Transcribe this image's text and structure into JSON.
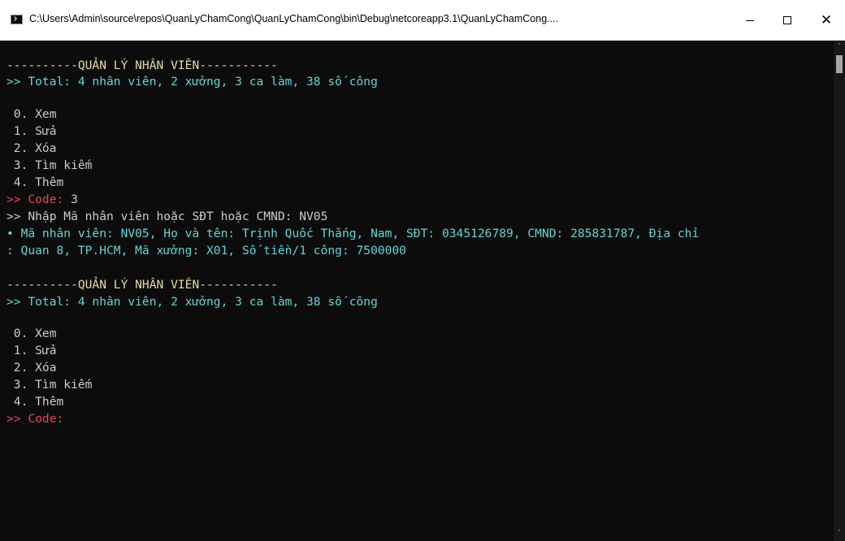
{
  "window": {
    "title": "C:\\Users\\Admin\\source\\repos\\QuanLyChamCong\\QuanLyChamCong\\bin\\Debug\\netcoreapp3.1\\QuanLyChamCong....",
    "minimize_glyph": "—",
    "maximize_glyph": "☐",
    "close_glyph": "✕",
    "icon": "console-icon"
  },
  "colors": {
    "background": "#0c0c0c",
    "header_text": "#e8d8a8",
    "info_text": "#61d6d6",
    "prompt_text": "#e74856",
    "default_text": "#cccccc"
  },
  "console": {
    "block1": {
      "header": "----------QUẢN LÝ NHÂN VIÊN-----------",
      "total": ">> Total: 4 nhân viên, 2 xưởng, 3 ca làm, 38 số công",
      "menu": [
        " 0. Xem",
        " 1. Sửa",
        " 2. Xóa",
        " 3. Tìm kiếm",
        " 4. Thêm"
      ],
      "code_prompt": ">> Code: ",
      "code_value": "3",
      "search_prompt": ">> Nhập Mã nhân viên hoặc SĐT hoặc CMND: NV05",
      "result_line1": "• Mã nhân viên: NV05, Họ và tên: Trịnh Quốc Thắng, Nam, SĐT: 0345126789, CMND: 285831787, Địa chỉ",
      "result_line2": ": Quan 8, TP.HCM, Mã xưởng: X01, Số tiền/1 công: 7500000"
    },
    "block2": {
      "header": "----------QUẢN LÝ NHÂN VIÊN-----------",
      "total": ">> Total: 4 nhân viên, 2 xưởng, 3 ca làm, 38 số công",
      "menu": [
        " 0. Xem",
        " 1. Sửa",
        " 2. Xóa",
        " 3. Tìm kiếm",
        " 4. Thêm"
      ],
      "code_prompt": ">> Code:"
    }
  },
  "scrollbar": {
    "up_glyph": "˄",
    "down_glyph": "˅"
  }
}
